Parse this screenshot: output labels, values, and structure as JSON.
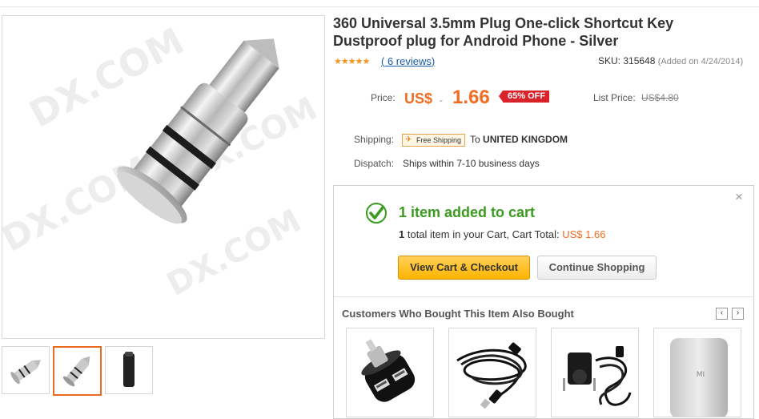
{
  "product": {
    "title_line1": "360 Universal 3.5mm Plug One-click Shortcut Key",
    "title_line2": "Dustproof plug for Android Phone - Silver",
    "rating_stars": 5,
    "reviews_open": "(",
    "reviews_text": "6 reviews",
    "reviews_close": ")",
    "sku_text": "SKU: 315648",
    "added_text": "(Added on 4/24/2014)"
  },
  "gallery": {
    "watermark": "DX.COM",
    "thumbnails": [
      {
        "icon": "plug-side-icon",
        "active": false
      },
      {
        "icon": "plug-angle-icon",
        "active": true
      },
      {
        "icon": "plug-black-icon",
        "active": false
      }
    ]
  },
  "pricing": {
    "price_label": "Price:",
    "currency": "US$",
    "currency_caret": "⌄",
    "price": "1.66",
    "discount_badge": "65% OFF",
    "list_label": "List Price:",
    "list_price": "US$4.80"
  },
  "shipping": {
    "label": "Shipping:",
    "badge": "Free Shipping",
    "to_prefix": "To",
    "destination": "UNITED KINGDOM",
    "dispatch_label": "Dispatch:",
    "dispatch_value": "Ships within 7-10 business days"
  },
  "cart_popup": {
    "close_glyph": "×",
    "headline": "1 item added to cart",
    "count": "1",
    "summary_text": " total item in your Cart, Cart Total: ",
    "total": "US$ 1.66",
    "checkout_button": "View Cart & Checkout",
    "continue_button": "Continue Shopping",
    "also_bought_heading": "Customers Who Bought This Item Also Bought",
    "nav_prev": "‹",
    "nav_next": "›",
    "products": [
      {
        "icon": "car-charger-icon"
      },
      {
        "icon": "usb-cable-icon"
      },
      {
        "icon": "wall-charger-icon"
      },
      {
        "icon": "power-bank-icon"
      }
    ],
    "power_bank_brand": "MI"
  },
  "colors": {
    "accent_orange": "#f36c21",
    "success_green": "#3a9c1f",
    "badge_red": "#d9222a",
    "link_blue": "#1a5ba6"
  }
}
